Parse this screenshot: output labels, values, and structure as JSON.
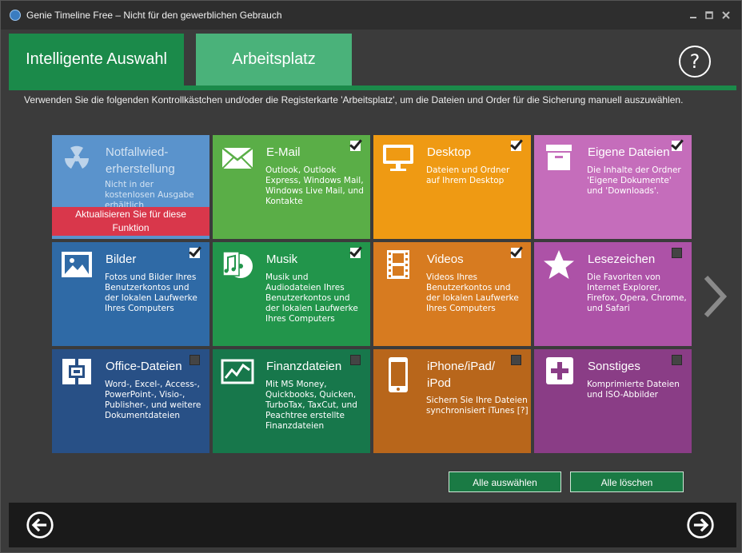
{
  "window": {
    "title": "Genie Timeline Free – Nicht für den gewerblichen Gebrauch"
  },
  "tabs": [
    {
      "label": "Intelligente Auswahl",
      "active": true
    },
    {
      "label": "Arbeitsplatz",
      "active": false
    }
  ],
  "help": {
    "label": "?"
  },
  "instructions": "Verwenden Sie die folgenden Kontrollkästchen und/oder die Registerkarte 'Arbeitsplatz', um die Dateien und Order für die Sicherung manuell auszuwählen.",
  "tiles": [
    {
      "name": "Notfallwied-\nerherstellung",
      "desc": "Nicht in der\nkostenlosen Ausgabe\nerhältlich",
      "icon": "radiation-icon",
      "color": "#4f89c3",
      "checked": null,
      "upgrade": "Aktualisieren Sie für diese\nFunktion"
    },
    {
      "name": "E-Mail",
      "desc": "Outlook, Outlook\nExpress, Windows Mail,\nWindows Live Mail, und\nKontakte",
      "icon": "email-icon",
      "color": "#5aae47",
      "checked": true
    },
    {
      "name": "Desktop",
      "desc": "Dateien und Ordner\nauf Ihrem Desktop",
      "icon": "monitor-icon",
      "color": "#ef9a13",
      "checked": true
    },
    {
      "name": "Eigene Dateien",
      "desc": "Die Inhalte der Ordner\n'Eigene Dokumente'\nund 'Downloads'.",
      "icon": "archive-box-icon",
      "color": "#c56dbb",
      "checked": true
    },
    {
      "name": "Bilder",
      "desc": "Fotos und Bilder Ihres\nBenutzerkontos und\nder lokalen Laufwerke\nIhres Computers",
      "icon": "picture-icon",
      "color": "#2f6aa6",
      "checked": true
    },
    {
      "name": "Musik",
      "desc": "Musik und\nAudiodateien Ihres\nBenutzerkontos und\nder lokalen Laufwerke\nIhres Computers",
      "icon": "music-disc-icon",
      "color": "#22954b",
      "checked": true
    },
    {
      "name": "Videos",
      "desc": "Videos Ihres\nBenutzerkontos und\nder lokalen Laufwerke\nIhres Computers",
      "icon": "film-icon",
      "color": "#d77b20",
      "checked": true
    },
    {
      "name": "Lesezeichen",
      "desc": "Die Favoriten von\nInternet Explorer,\nFirefox, Opera, Chrome,\nund Safari",
      "icon": "star-icon",
      "color": "#ad52a7",
      "checked": false
    },
    {
      "name": "Office-Dateien",
      "desc": "Word-, Excel-, Access-,\nPowerPoint-, Visio-,\nPublisher-, und weitere\nDokumentdateien",
      "icon": "office-icon",
      "color": "#285086",
      "checked": false
    },
    {
      "name": "Finanzdateien",
      "desc": "Mit MS Money,\nQuickbooks, Quicken,\nTurboTax, TaxCut, und\nPeachtree erstellte\nFinanzdateien",
      "icon": "chart-icon",
      "color": "#17774b",
      "checked": false
    },
    {
      "name": "iPhone/iPad/\niPod",
      "desc": "Sichern Sie Ihre Dateien\nsynchronisiert iTunes [?]",
      "icon": "phone-icon",
      "color": "#b8661b",
      "checked": false
    },
    {
      "name": "Sonstiges",
      "desc": "Komprimierte Dateien\nund ISO-Abbilder",
      "icon": "plus-box-icon",
      "color": "#8a3d86",
      "checked": false
    }
  ],
  "buttons": {
    "select_all": "Alle auswählen",
    "clear_all": "Alle löschen"
  },
  "nav": {
    "back_icon": "arrow-left-circle-icon",
    "next_icon": "arrow-right-circle-icon",
    "more_icon": "chevron-right-icon"
  }
}
